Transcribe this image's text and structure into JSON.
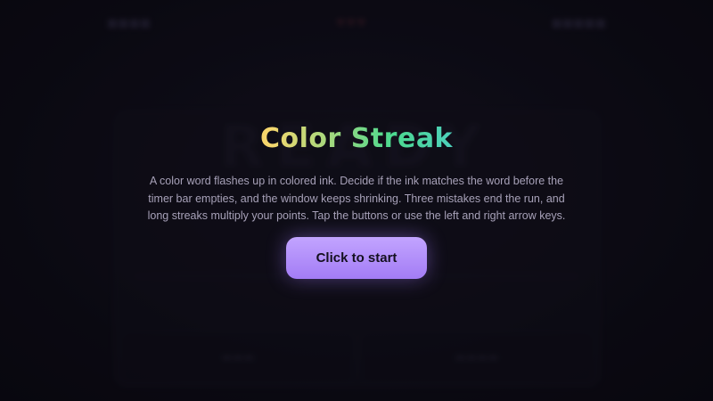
{
  "game": {
    "title": "Color Streak",
    "description": "A color word flashes up in colored ink. Decide if the ink matches the word before the timer bar empties, and the window keeps shrinking. Three mistakes end the run, and long streaks multiply your points. Tap the buttons or use the left and right arrow keys.",
    "start_label": "Click to start",
    "title_gradient": [
      "#ff6b6b",
      "#ffb347",
      "#f5d76e",
      "#4cd98f",
      "#4fc3f7",
      "#a78bfa"
    ],
    "accent_color": "#a37cf5"
  },
  "background": {
    "word": "READY"
  }
}
